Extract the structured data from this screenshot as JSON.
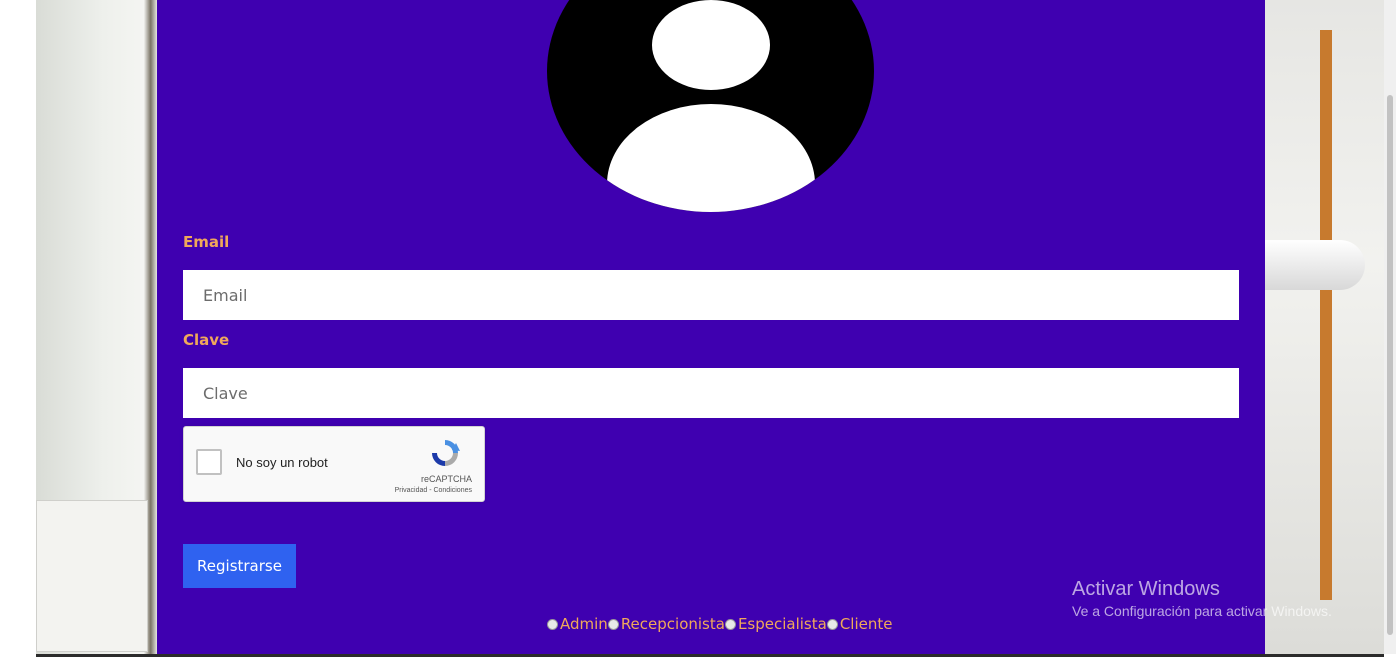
{
  "form": {
    "email_label": "Email",
    "email_placeholder": "Email",
    "password_label": "Clave",
    "password_placeholder": "Clave",
    "submit_label": "Registrarse"
  },
  "recaptcha": {
    "checkbox_label": "No soy un robot",
    "brand": "reCAPTCHA",
    "terms": "Privacidad - Condiciones"
  },
  "roles": {
    "options": [
      "Admin",
      "Recepcionista",
      "Especialista",
      "Cliente"
    ]
  },
  "watermark": {
    "title": "Activar Windows",
    "subtitle": "Ve a Configuración para activar Windows."
  },
  "colors": {
    "card_background": "#3f00b0",
    "label_color": "#f0a85a",
    "button_color": "#2f62f0"
  }
}
